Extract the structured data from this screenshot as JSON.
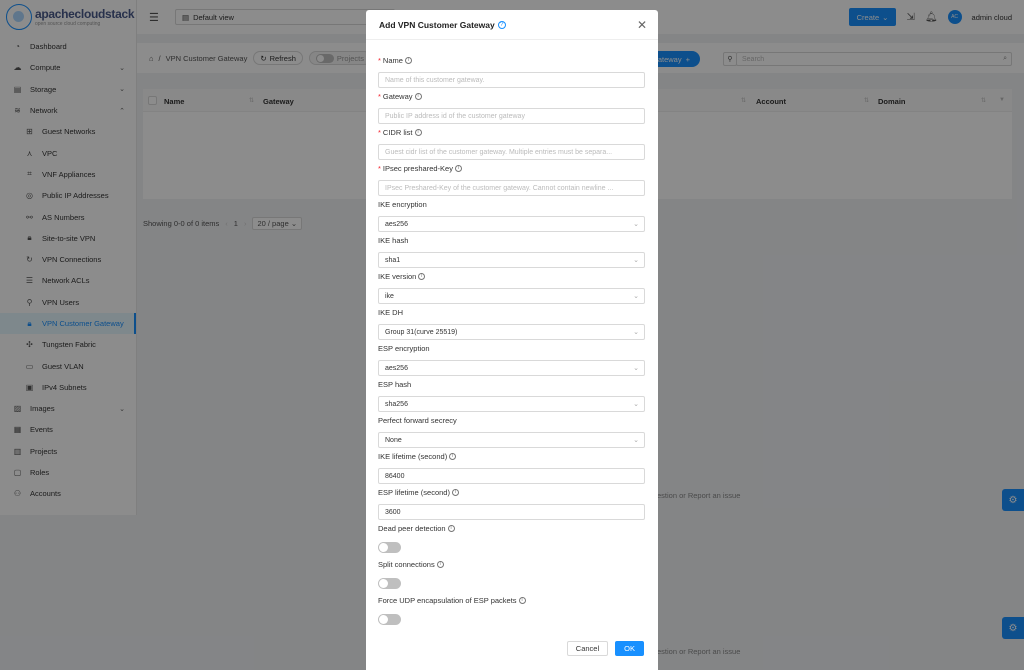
{
  "brand": {
    "name": "apachecloudstack",
    "tagline": "open source cloud computing"
  },
  "header": {
    "project": "Default view",
    "create_label": "Create",
    "user_initials": "AC",
    "user_name": "admin cloud"
  },
  "sidebar": {
    "items": [
      {
        "label": "Dashboard",
        "icon": "dashboard-icon"
      },
      {
        "label": "Compute",
        "icon": "cloud-icon"
      },
      {
        "label": "Storage",
        "icon": "database-icon"
      },
      {
        "label": "Network",
        "icon": "wifi-icon"
      },
      {
        "label": "Guest Networks",
        "icon": "apartment-icon"
      },
      {
        "label": "VPC",
        "icon": "deployment-icon"
      },
      {
        "label": "VNF Appliances",
        "icon": "gateway-icon"
      },
      {
        "label": "Public IP Addresses",
        "icon": "environment-icon"
      },
      {
        "label": "AS Numbers",
        "icon": "partition-icon"
      },
      {
        "label": "Site-to-site VPN",
        "icon": "lock-icon"
      },
      {
        "label": "VPN Connections",
        "icon": "sync-icon"
      },
      {
        "label": "Network ACLs",
        "icon": "list-icon"
      },
      {
        "label": "VPN Users",
        "icon": "user-icon"
      },
      {
        "label": "VPN Customer Gateway",
        "icon": "lock-icon"
      },
      {
        "label": "Tungsten Fabric",
        "icon": "tungsten-icon"
      },
      {
        "label": "Guest VLAN",
        "icon": "folder-icon"
      },
      {
        "label": "IPv4 Subnets",
        "icon": "ip-icon"
      },
      {
        "label": "Images",
        "icon": "picture-icon"
      },
      {
        "label": "Events",
        "icon": "schedule-icon"
      },
      {
        "label": "Projects",
        "icon": "project-icon"
      },
      {
        "label": "Roles",
        "icon": "idcard-icon"
      },
      {
        "label": "Accounts",
        "icon": "team-icon"
      }
    ]
  },
  "toolbar": {
    "breadcrumb": "VPN Customer Gateway",
    "refresh_label": "Refresh",
    "projects_label": "Projects",
    "add_label": "Gateway",
    "search_placeholder": "Search"
  },
  "table": {
    "columns": [
      "Name",
      "Gateway",
      "Account",
      "Domain"
    ],
    "summary": "Showing 0-0 of 0 items",
    "page": "1",
    "page_size": "20 / page"
  },
  "footer_note": "estion or Report an issue",
  "modal": {
    "title": "Add VPN Customer Gateway",
    "fields": {
      "name": {
        "label": "Name",
        "placeholder": "Name of this customer gateway."
      },
      "gateway": {
        "label": "Gateway",
        "placeholder": "Public IP address id of the customer gateway"
      },
      "cidr": {
        "label": "CIDR list",
        "placeholder": "Guest cidr list of the customer gateway. Multiple entries must be separa..."
      },
      "psk": {
        "label": "IPsec preshared-Key",
        "placeholder": "IPsec Preshared-Key of the customer gateway. Cannot contain newline ..."
      },
      "ike_enc": {
        "label": "IKE encryption",
        "value": "aes256"
      },
      "ike_hash": {
        "label": "IKE hash",
        "value": "sha1"
      },
      "ike_version": {
        "label": "IKE version",
        "value": "ike"
      },
      "ike_dh": {
        "label": "IKE DH",
        "value": "Group 31(curve 25519)"
      },
      "esp_enc": {
        "label": "ESP encryption",
        "value": "aes256"
      },
      "esp_hash": {
        "label": "ESP hash",
        "value": "sha256"
      },
      "pfs": {
        "label": "Perfect forward secrecy",
        "value": "None"
      },
      "ike_life": {
        "label": "IKE lifetime (second)",
        "value": "86400"
      },
      "esp_life": {
        "label": "ESP lifetime (second)",
        "value": "3600"
      },
      "dpd": {
        "label": "Dead peer detection"
      },
      "split": {
        "label": "Split connections"
      },
      "force_udp": {
        "label": "Force UDP encapsulation of ESP packets"
      }
    },
    "cancel_label": "Cancel",
    "ok_label": "OK"
  }
}
